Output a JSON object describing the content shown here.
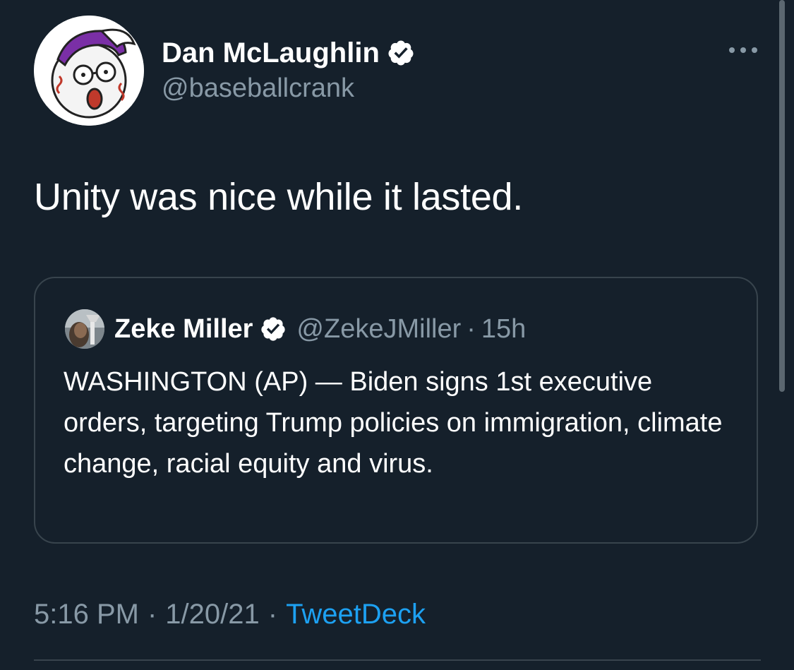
{
  "tweet": {
    "author": {
      "name": "Dan McLaughlin",
      "handle": "@baseballcrank",
      "avatar_icon": "cartoon-baseball-avatar-icon",
      "verified_icon": "verified-badge-icon"
    },
    "more_icon": "more-options-icon",
    "text": "Unity was nice while it lasted.",
    "quoted": {
      "name": "Zeke Miller",
      "handle": "@ZekeJMiller",
      "separator": "·",
      "time": "15h",
      "text": "WASHINGTON (AP) — Biden signs 1st executive orders, targeting Trump policies on immigration, climate change, racial equity and virus.",
      "avatar_icon": "profile-photo-icon",
      "verified_icon": "verified-badge-icon"
    },
    "meta": {
      "time": "5:16 PM",
      "separator": "·",
      "date": "1/20/21",
      "source": "TweetDeck"
    }
  },
  "colors": {
    "background": "#15202b",
    "primary_text": "#ffffff",
    "secondary_text": "#8899a6",
    "accent": "#1da1f2",
    "border": "#38444d"
  }
}
